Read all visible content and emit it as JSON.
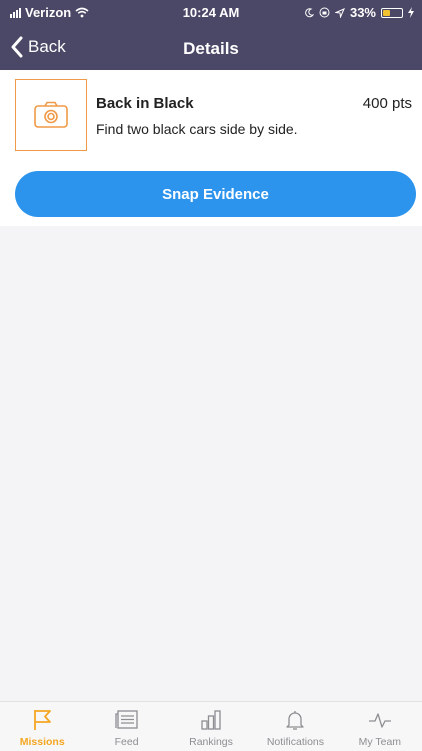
{
  "status_bar": {
    "carrier": "Verizon",
    "time": "10:24 AM",
    "battery": "33%"
  },
  "nav": {
    "back_label": "Back",
    "title": "Details"
  },
  "mission": {
    "title": "Back in Black",
    "points": "400 pts",
    "description": "Find two black cars side by side.",
    "cta": "Snap Evidence"
  },
  "tabs": [
    {
      "label": "Missions",
      "icon": "flag-icon",
      "active": true
    },
    {
      "label": "Feed",
      "icon": "feed-icon",
      "active": false
    },
    {
      "label": "Rankings",
      "icon": "rankings-icon",
      "active": false
    },
    {
      "label": "Notifications",
      "icon": "bell-icon",
      "active": false
    },
    {
      "label": "My Team",
      "icon": "pulse-icon",
      "active": false
    }
  ],
  "colors": {
    "header": "#4a4866",
    "accent": "#2d94ee",
    "active_tab": "#f5a623",
    "thumb_border": "#f09a47"
  }
}
